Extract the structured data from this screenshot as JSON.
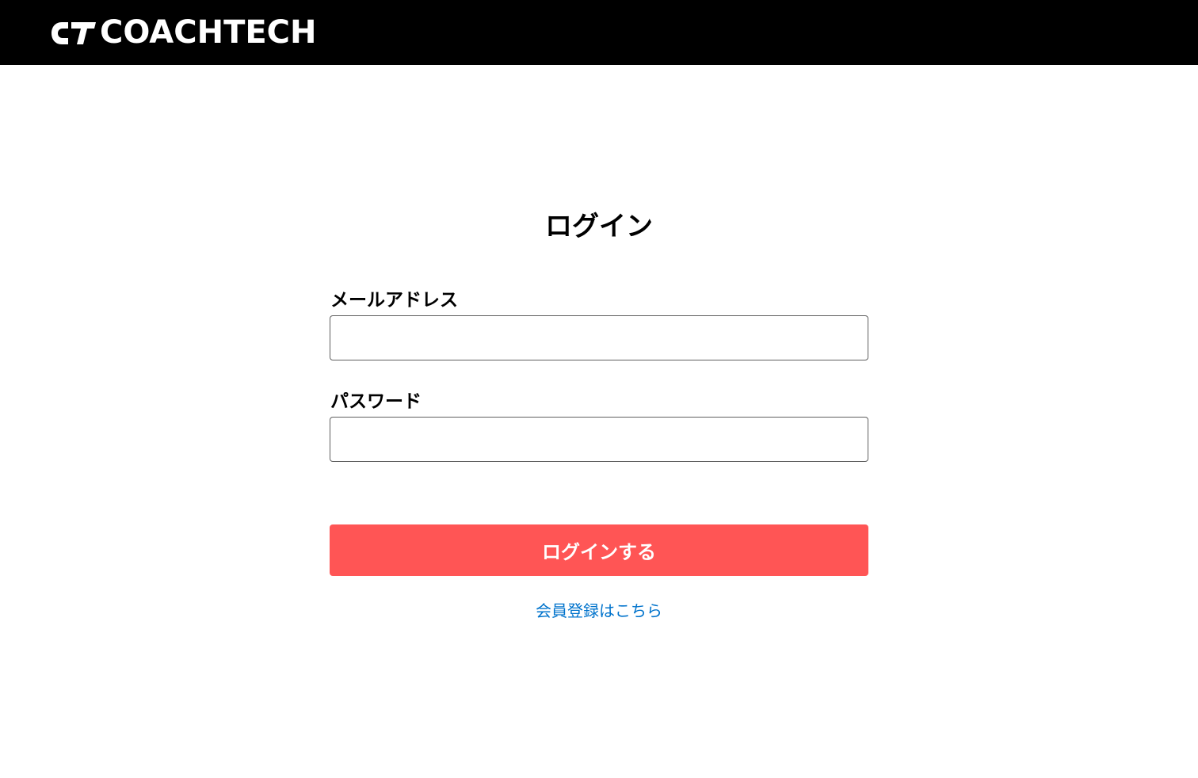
{
  "header": {
    "logo_text": "COACHTECH",
    "logo_mark": "CT",
    "background": "#000000"
  },
  "page": {
    "title": "ログイン"
  },
  "form": {
    "email": {
      "label": "メールアドレス",
      "value": "",
      "placeholder": ""
    },
    "password": {
      "label": "パスワード",
      "value": "",
      "placeholder": ""
    },
    "submit_label": "ログインする",
    "submit_color": "#ff5555"
  },
  "links": {
    "register_label": "会員登録はこちら",
    "link_color": "#0073cc"
  }
}
